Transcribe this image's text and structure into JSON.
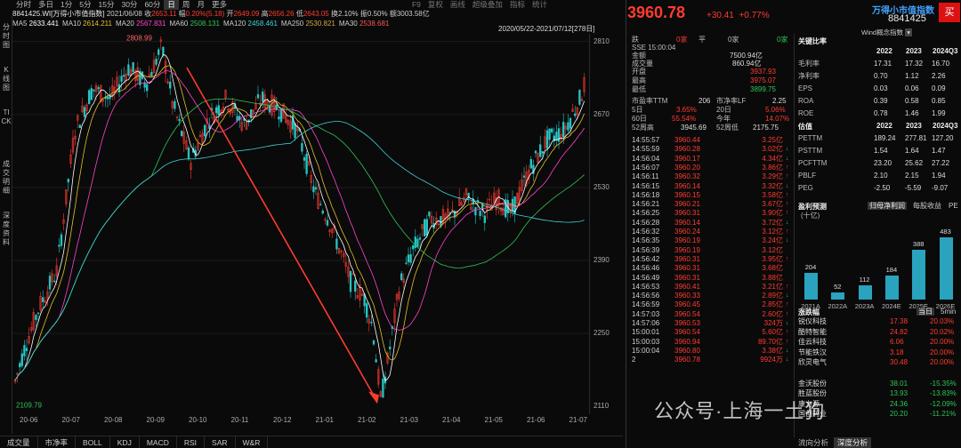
{
  "toolbar": {
    "items": [
      "分时",
      "多日",
      "1分",
      "5分",
      "15分",
      "30分",
      "60分",
      "日",
      "周",
      "月",
      "更多"
    ],
    "active": 7,
    "tools": [
      "F9",
      "复权",
      "画线",
      "超级叠加",
      "指标",
      "统计"
    ]
  },
  "leftnav": {
    "items": [
      "分时图",
      "K线图",
      "TICK",
      "成交明细",
      "深度资料"
    ]
  },
  "info": {
    "code": "8841425.WI[万得小市值指数]",
    "date": "2021/06/08",
    "close_label": "收",
    "close": "2653.11",
    "chg_label": "幅",
    "chg": "0.20%(5.18)",
    "open_label": "开",
    "open": "2649.09",
    "high_label": "高",
    "high": "2656.26",
    "low_label": "低",
    "low": "2643.05",
    "turn_label": "换",
    "turn": "2.10%",
    "amp_label": "振",
    "amp": "0.50%",
    "amt_label": "额",
    "amt": "3003.58亿"
  },
  "ma": [
    {
      "label": "MA5",
      "val": "2633.441",
      "color": "#ffffff"
    },
    {
      "label": "MA10",
      "val": "2614.211",
      "color": "#e6c229"
    },
    {
      "label": "MA20",
      "val": "2567.831",
      "color": "#ff44cc"
    },
    {
      "label": "MA60",
      "val": "2508.131",
      "color": "#2fc455"
    },
    {
      "label": "MA120",
      "val": "2458.461",
      "color": "#3fd3d8"
    },
    {
      "label": "MA250",
      "val": "2530.821",
      "color": "#d4a640"
    },
    {
      "label": "MA30",
      "val": "2538.681",
      "color": "#ff5555"
    }
  ],
  "range": "2020/05/22-2021/07/12[278日]",
  "chart_labels": {
    "high": "2808.99",
    "low": "2109.79"
  },
  "chart_data": {
    "type": "candlestick",
    "y_ticks": [
      "2810",
      "2670",
      "2530",
      "2390",
      "2250",
      "2110"
    ],
    "y_range": [
      2095,
      2825
    ],
    "x_ticks": [
      "20-06",
      "20-07",
      "20-08",
      "20-09",
      "20-10",
      "20-11",
      "20-12",
      "21-01",
      "21-02",
      "21-03",
      "21-04",
      "21-05",
      "21-06",
      "21-07"
    ],
    "period_max": 2808.99,
    "period_min": 2109.79
  },
  "bottom_tabs": [
    "成交量",
    "市净率",
    "BOLL",
    "KDJ",
    "MACD",
    "RSI",
    "SAR",
    "W&R"
  ],
  "quote": {
    "price": "3960.78",
    "change": "+30.41",
    "pct": "+0.77%",
    "name": "万得小市值指数",
    "code": "8841425",
    "wind": "Wind概念指数",
    "buy": "买"
  },
  "stats": {
    "up_label": "跌",
    "up": "0家",
    "flat_label": "平",
    "flat": "0家",
    "down": "0家",
    "sse": "SSE 15:00:04",
    "amt_label": "金额",
    "amt": "7500.94亿",
    "vol_label": "成交量",
    "vol": "860.94亿",
    "open_label": "开盘",
    "open": "3937.93",
    "high_label": "最高",
    "high": "3975.07",
    "low_label": "最低",
    "low": "3899.75",
    "pe_label": "市盈率TTM",
    "pe": "206",
    "pb_label": "市净率LF",
    "pb": "2.25",
    "d5_label": "5日",
    "d5": "3.65%",
    "d20_label": "20日",
    "d20": "5.06%",
    "d60_label": "60日",
    "d60": "55.54%",
    "ytd_label": "今年",
    "ytd": "14.07%",
    "w52h_label": "52周高",
    "w52h": "3945.69",
    "w52l_label": "52周低",
    "w52l": "2175.75"
  },
  "ticks": [
    [
      "14:55:57",
      "3960.44",
      "3.25亿",
      ""
    ],
    [
      "14:55:59",
      "3960.28",
      "3.02亿",
      "↓"
    ],
    [
      "14:56:04",
      "3960.17",
      "4.34亿",
      "↓"
    ],
    [
      "14:56:07",
      "3960.20",
      "3.86亿",
      "↑"
    ],
    [
      "14:56:11",
      "3960.32",
      "3.29亿",
      "↑"
    ],
    [
      "14:56:15",
      "3960.14",
      "3.32亿",
      "↓"
    ],
    [
      "14:56:18",
      "3960.15",
      "3.58亿",
      "↑"
    ],
    [
      "14:56:21",
      "3960.21",
      "3.67亿",
      "↑"
    ],
    [
      "14:56:25",
      "3960.31",
      "3.90亿",
      "↑"
    ],
    [
      "14:56:28",
      "3960.14",
      "3.72亿",
      "↓"
    ],
    [
      "14:56:32",
      "3960.24",
      "3.12亿",
      "↑"
    ],
    [
      "14:56:35",
      "3960.19",
      "3.24亿",
      "↓"
    ],
    [
      "14:56:39",
      "3960.19",
      "3.12亿",
      ""
    ],
    [
      "14:56:42",
      "3960.31",
      "3.95亿",
      "↑"
    ],
    [
      "14:56:46",
      "3960.31",
      "3.68亿",
      ""
    ],
    [
      "14:56:49",
      "3960.31",
      "3.88亿",
      ""
    ],
    [
      "14:56:53",
      "3960.41",
      "3.21亿",
      "↑"
    ],
    [
      "14:56:56",
      "3960.33",
      "2.89亿",
      "↓"
    ],
    [
      "14:56:59",
      "3960.45",
      "2.85亿",
      "↑"
    ],
    [
      "14:57:03",
      "3960.54",
      "2.60亿",
      "↑"
    ],
    [
      "14:57:06",
      "3960.53",
      "324万",
      "↓"
    ],
    [
      "15:00:01",
      "3960.54",
      "5.60亿",
      "↑"
    ],
    [
      "15:00:03",
      "3960.94",
      "89.70亿",
      "↑"
    ],
    [
      "15:00:04",
      "3960.80",
      "3.38亿",
      "↓"
    ],
    [
      "2",
      "3960.78",
      "9924万",
      "↓"
    ]
  ],
  "key": {
    "title": "关键比率",
    "years": [
      "2022",
      "2023",
      "2024Q3"
    ],
    "rows": [
      [
        "毛利率",
        "17.31",
        "17.32",
        "16.70"
      ],
      [
        "净利率",
        "0.70",
        "1.12",
        "2.26"
      ],
      [
        "EPS",
        "0.03",
        "0.06",
        "0.09"
      ],
      [
        "ROA",
        "0.39",
        "0.58",
        "0.85"
      ],
      [
        "ROE",
        "0.78",
        "1.46",
        "1.99"
      ]
    ]
  },
  "val": {
    "title": "估值",
    "years": [
      "2022",
      "2023",
      "2024Q3"
    ],
    "rows": [
      [
        "PETTM",
        "189.24",
        "277.81",
        "127.20"
      ],
      [
        "PSTTM",
        "1.54",
        "1.64",
        "1.47"
      ],
      [
        "PCFTTM",
        "23.20",
        "25.62",
        "27.22"
      ],
      [
        "PBLF",
        "2.10",
        "2.15",
        "1.94"
      ],
      [
        "PEG",
        "-2.50",
        "-5.59",
        "-9.07"
      ]
    ]
  },
  "forecast": {
    "title": "盈利预测",
    "unit": "(十亿)",
    "tab1": "归母净利润",
    "tab2": "每股收益",
    "tab3": "PE",
    "bars": [
      {
        "label": "2021A",
        "value": 204
      },
      {
        "label": "2022A",
        "value": 52
      },
      {
        "label": "2023A",
        "value": 112
      },
      {
        "label": "2024E",
        "value": 184
      },
      {
        "label": "2025E",
        "value": 388
      },
      {
        "label": "2026E",
        "value": 483
      }
    ]
  },
  "movers": {
    "title": "涨跌幅",
    "tab1": "当日",
    "tab2": "5min",
    "rows": [
      [
        "锐仪科技",
        "17.38",
        "20.03%"
      ],
      [
        "酷特智能",
        "24.82",
        "20.02%"
      ],
      [
        "佳云科技",
        "6.06",
        "20.00%"
      ],
      [
        "节能铁汉",
        "3.18",
        "20.00%"
      ],
      [
        "欣灵电气",
        "30.48",
        "20.00%"
      ],
      [
        "金沃股份",
        "38.01",
        "-15.35%"
      ],
      [
        "胜蓝股份",
        "13.93",
        "-13.83%"
      ],
      [
        "康力源",
        "24.36",
        "-12.09%"
      ],
      [
        "国创药业",
        "20.20",
        "-11.21%"
      ]
    ]
  },
  "rbtabs": [
    "流向分析",
    "深度分析"
  ],
  "watermark": "公众号·上海一土狗"
}
